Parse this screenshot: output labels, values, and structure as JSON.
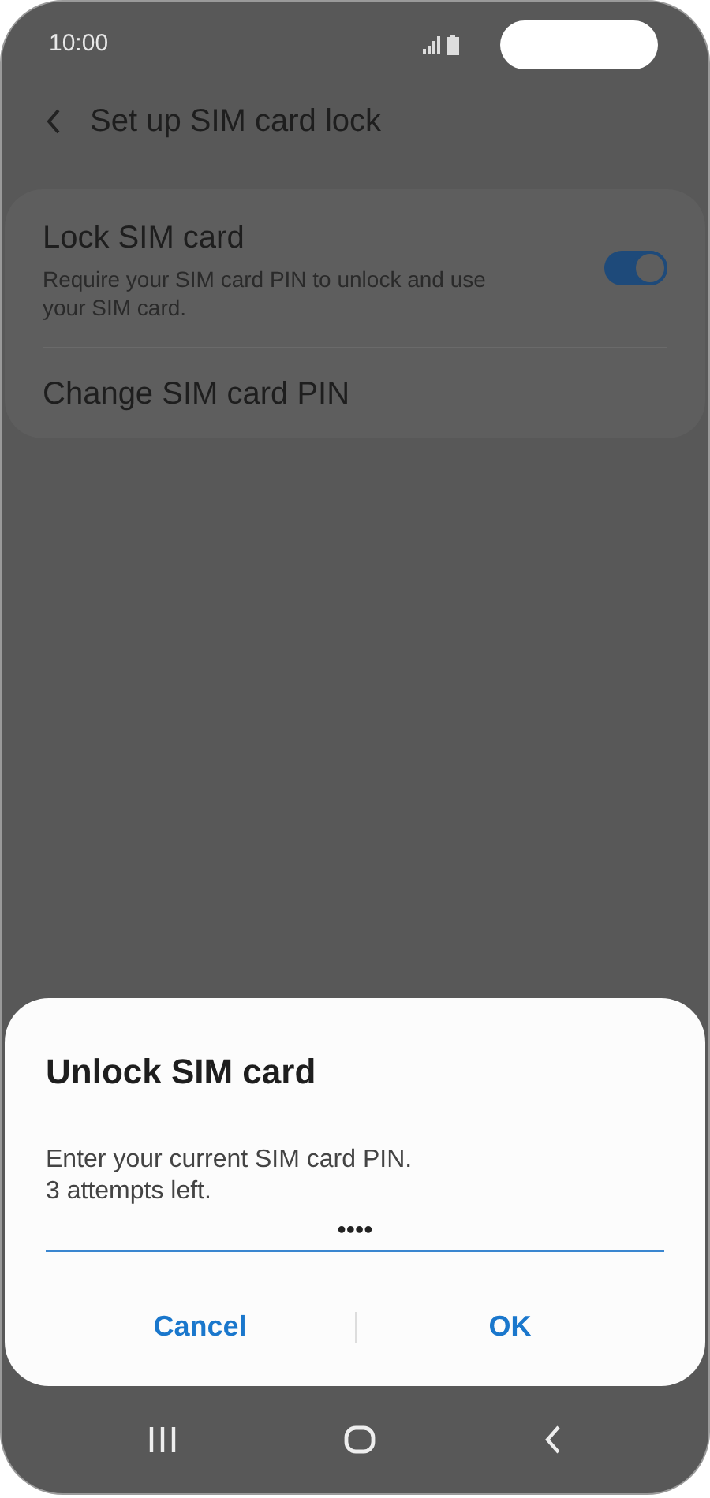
{
  "status_bar": {
    "time": "10:00"
  },
  "header": {
    "title": "Set up SIM card lock"
  },
  "settings": {
    "items": [
      {
        "kind": "switch",
        "title": "Lock SIM card",
        "description": "Require your SIM card PIN to unlock and use your SIM card.",
        "on": true
      },
      {
        "kind": "plain",
        "title": "Change SIM card PIN"
      }
    ]
  },
  "dialog": {
    "title": "Unlock SIM card",
    "message": [
      "Enter your current SIM card PIN.",
      "3 attempts left."
    ],
    "pin_value": "••••",
    "buttons": [
      "Cancel",
      "OK"
    ]
  }
}
